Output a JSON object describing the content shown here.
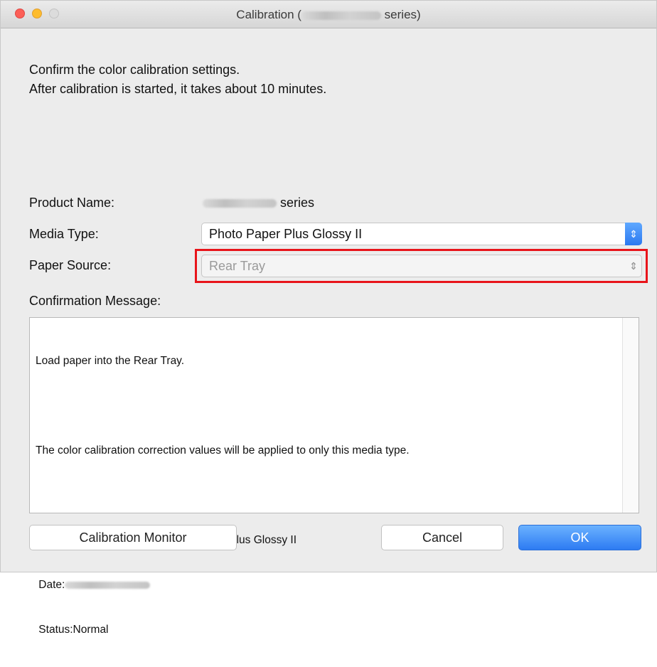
{
  "window": {
    "title_prefix": "Calibration (",
    "title_suffix": " series)"
  },
  "intro": {
    "line1": "Confirm the color calibration settings.",
    "line2": "After calibration is started, it takes about 10 minutes."
  },
  "fields": {
    "product_name_label": "Product Name:",
    "product_name_suffix": "series",
    "media_type_label": "Media Type:",
    "media_type_value": "Photo Paper Plus Glossy II",
    "paper_source_label": "Paper Source:",
    "paper_source_value": "Rear Tray"
  },
  "confirmation": {
    "label": "Confirmation Message:",
    "line1": "Load paper into the Rear Tray.",
    "line2": "The color calibration correction values will be applied to only this media type.",
    "line3": "Calibration information for Photo Paper Plus Glossy II",
    "date_label": " Date:",
    "status_line": " Status:Normal"
  },
  "buttons": {
    "calibration_monitor": "Calibration Monitor",
    "cancel": "Cancel",
    "ok": "OK"
  },
  "colors": {
    "highlight": "#e8141a",
    "accent": "#2d7bf2"
  }
}
